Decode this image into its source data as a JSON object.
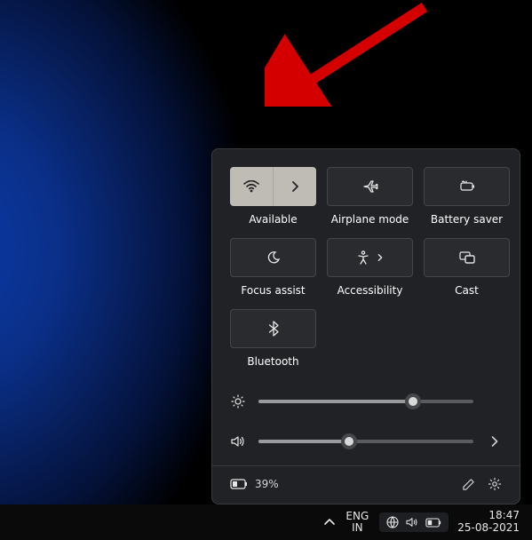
{
  "tiles": {
    "wifi": {
      "label": "Available"
    },
    "airplane": {
      "label": "Airplane mode"
    },
    "battery": {
      "label": "Battery saver"
    },
    "focus": {
      "label": "Focus assist"
    },
    "a11y": {
      "label": "Accessibility"
    },
    "cast": {
      "label": "Cast"
    },
    "bluetooth": {
      "label": "Bluetooth"
    }
  },
  "sliders": {
    "brightness": {
      "value": 72
    },
    "volume": {
      "value": 42
    }
  },
  "footer": {
    "battery_text": "39%"
  },
  "taskbar": {
    "lang_top": "ENG",
    "lang_bottom": "IN",
    "time": "18:47",
    "date": "25-08-2021"
  }
}
